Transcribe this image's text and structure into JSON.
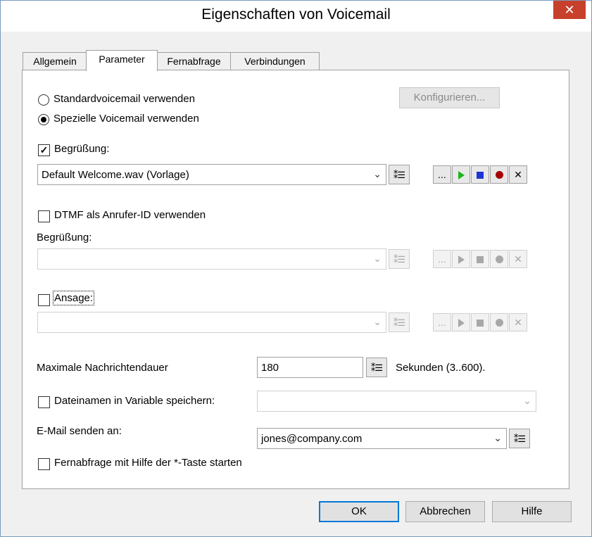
{
  "window": {
    "title": "Eigenschaften von Voicemail",
    "close_glyph": "✕"
  },
  "tabs": [
    {
      "label": "Allgemein"
    },
    {
      "label": "Parameter"
    },
    {
      "label": "Fernabfrage"
    },
    {
      "label": "Verbindungen"
    }
  ],
  "mode": {
    "standard_label": "Standardvoicemail verwenden",
    "special_label": "Spezielle Voicemail verwenden",
    "selected": "special",
    "configure_button": "Konfigurieren..."
  },
  "greeting": {
    "checked": true,
    "label": "Begrüßung:",
    "file_value": "Default Welcome.wav (Vorlage)"
  },
  "dtmf": {
    "checked": false,
    "label": "DTMF als Anrufer-ID verwenden",
    "greeting_label": "Begrüßung:",
    "file_value": ""
  },
  "announcement": {
    "checked": false,
    "label": "Ansage:",
    "file_value": ""
  },
  "max_duration": {
    "label": "Maximale Nachrichtendauer",
    "value": "180",
    "unit_label": "Sekunden (3..600)."
  },
  "filename_var": {
    "checked": false,
    "label": "Dateinamen in Variable speichern:",
    "value": ""
  },
  "email": {
    "label": "E-Mail senden an:",
    "value": "jones@company.com"
  },
  "remote_query": {
    "checked": false,
    "label": "Fernabfrage mit Hilfe der *-Taste starten"
  },
  "buttons": {
    "ok": "OK",
    "cancel": "Abbrechen",
    "help": "Hilfe"
  },
  "icons": {
    "ellipsis": "...",
    "delete": "✕",
    "dropdown": "⌄",
    "list": "⁑☰"
  },
  "colors": {
    "close_bg": "#c7402c",
    "play": "#1fb31f",
    "stop": "#1e35d6",
    "record": "#a40000",
    "default_border": "#0078d7"
  }
}
